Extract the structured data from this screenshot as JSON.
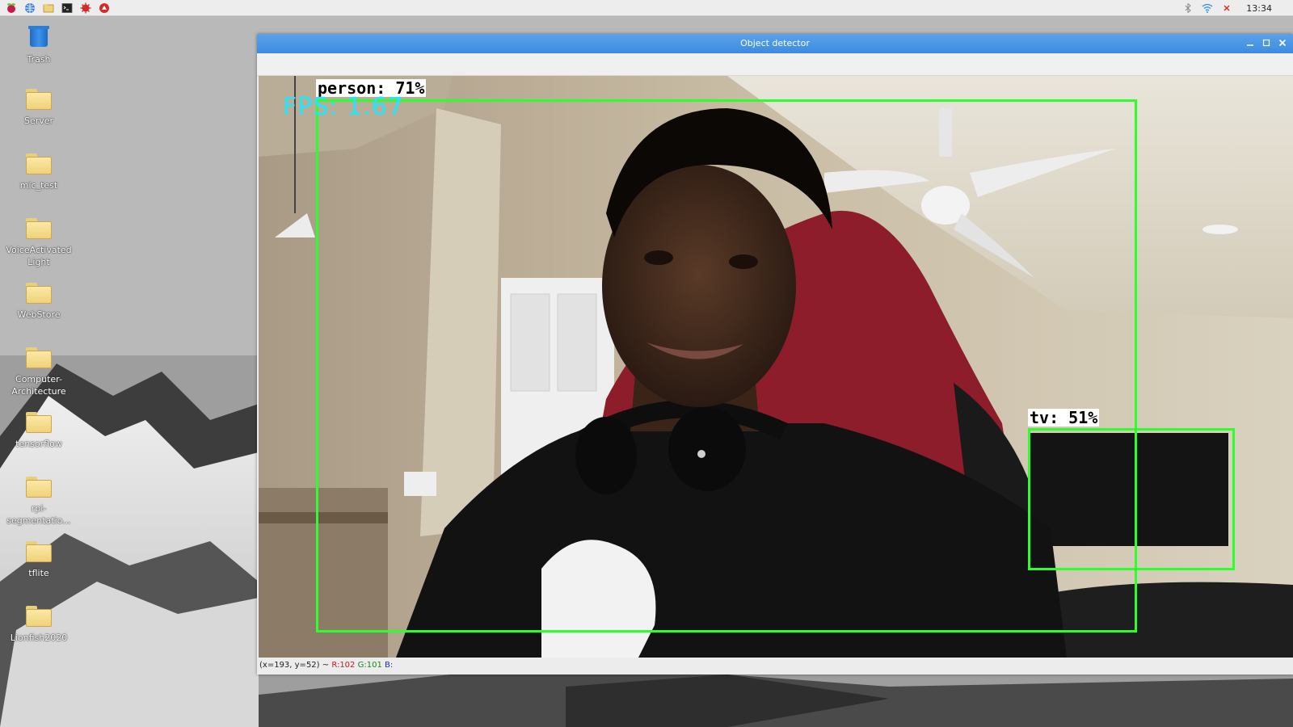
{
  "taskbar": {
    "launchers": [
      "raspberry-menu-icon",
      "web-browser-icon",
      "file-manager-icon",
      "terminal-icon",
      "math-app-icon",
      "wolfram-icon"
    ],
    "tray": [
      "bluetooth-icon",
      "wifi-icon",
      "volume-mute-icon"
    ],
    "clock": "13:34"
  },
  "desktop": {
    "icons": [
      {
        "label": "Trash",
        "type": "trash"
      },
      {
        "label": "Server",
        "type": "folder"
      },
      {
        "label": "mic_test",
        "type": "folder"
      },
      {
        "label": "VoiceActivated Light",
        "type": "folder"
      },
      {
        "label": "WebStore",
        "type": "folder"
      },
      {
        "label": "Computer-Architecture",
        "type": "folder"
      },
      {
        "label": "tensorflow",
        "type": "folder"
      },
      {
        "label": "rpi-segmentatio...",
        "type": "folder"
      },
      {
        "label": "tflite",
        "type": "folder"
      },
      {
        "label": "Lionfish2020",
        "type": "folder"
      }
    ]
  },
  "window": {
    "title": "Object detector",
    "fps_text": "FPS: 1.67",
    "detections": [
      {
        "label": "person: 71%",
        "color": "#2cff2c"
      },
      {
        "label": "tv: 51%",
        "color": "#2cff2c"
      }
    ],
    "status": {
      "coords": "(x=193, y=52) ~",
      "r": "R:102",
      "g": "G:101",
      "b": "B:"
    }
  },
  "colors": {
    "titlebar": "#3d8be0",
    "bbox": "#2cff2c",
    "fps": "#21e6ff"
  }
}
